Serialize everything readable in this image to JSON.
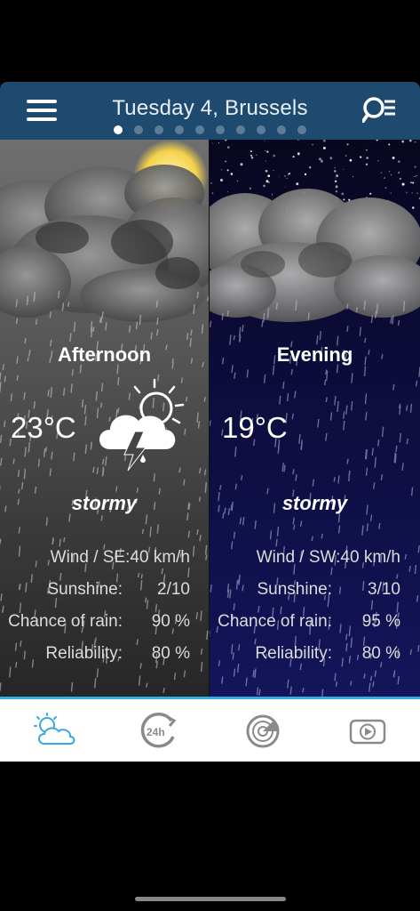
{
  "header": {
    "title": "Tuesday 4, Brussels",
    "page_count": 10,
    "active_page": 0
  },
  "panels": [
    {
      "period": "Afternoon",
      "temperature": "23°C",
      "condition": "stormy",
      "wind_label": "Wind / SE:40 km/h",
      "sunshine_label": "Sunshine:",
      "sunshine_value": "2/10",
      "rain_label": "Chance of rain:",
      "rain_value": "90 %",
      "reliability_label": "Reliability:",
      "reliability_value": "80 %"
    },
    {
      "period": "Evening",
      "temperature": "19°C",
      "condition": "stormy",
      "wind_label": "Wind / SW:40 km/h",
      "sunshine_label": "Sunshine:",
      "sunshine_value": "3/10",
      "rain_label": "Chance of rain:",
      "rain_value": "95 %",
      "reliability_label": "Reliability:",
      "reliability_value": "80 %"
    }
  ],
  "tabs": [
    {
      "icon": "weather-icon",
      "active": true
    },
    {
      "icon": "24h-icon",
      "active": false
    },
    {
      "icon": "radar-icon",
      "active": false
    },
    {
      "icon": "video-icon",
      "active": false
    }
  ],
  "colors": {
    "header_bg": "#1d4a6e",
    "accent": "#3aa9e0",
    "inactive_icon": "#8a8a8a"
  }
}
